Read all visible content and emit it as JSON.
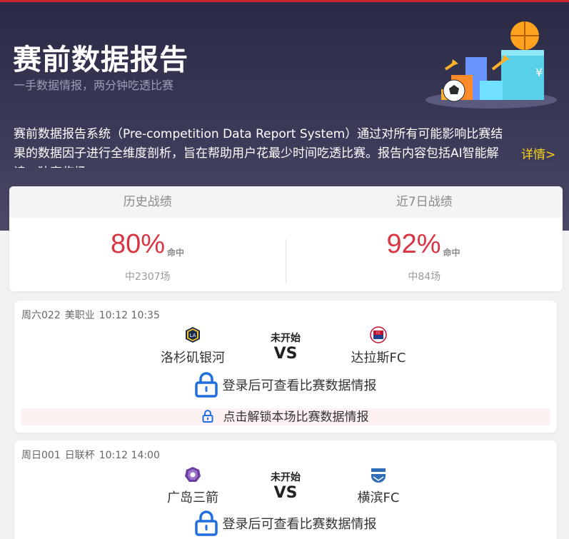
{
  "hero": {
    "title": "赛前数据报告",
    "subtitle": "一手数据情报，两分钟吃透比赛",
    "description": "赛前数据报告系统（Pre-competition Data Report System）通过对所有可能影响比赛结果的数据因子进行全维度剖析，旨在帮助用户花最少时间吃透比赛。报告内容包括AI智能解读、独家临场",
    "more_link": "详情>"
  },
  "stats": {
    "history": {
      "tab": "历史战绩",
      "percent": "80%",
      "label": "命中",
      "count": "中2307场"
    },
    "recent": {
      "tab": "近7日战绩",
      "percent": "92%",
      "label": "命中",
      "count": "中84场"
    }
  },
  "matches": [
    {
      "code": "周六022",
      "league": "美职业",
      "time": "10:12 10:35",
      "status": "未开始",
      "vs": "VS",
      "home": {
        "name": "洛杉矶银河",
        "logo": "la-galaxy-logo"
      },
      "away": {
        "name": "达拉斯FC",
        "logo": "fc-dallas-logo"
      },
      "login_text": "登录后可查看比赛数据情报",
      "unlock_text": "点击解锁本场比赛数据情报"
    },
    {
      "code": "周日001",
      "league": "日联杯",
      "time": "10:12 14:00",
      "status": "未开始",
      "vs": "VS",
      "home": {
        "name": "广岛三箭",
        "logo": "sanfrecce-hiroshima-logo"
      },
      "away": {
        "name": "横滨FC",
        "logo": "yokohama-fc-logo"
      },
      "login_text": "登录后可查看比赛数据情报"
    }
  ],
  "colors": {
    "accent_red": "#d93442",
    "link_yellow": "#ffd319",
    "lock_blue": "#1f6fe0",
    "hero_bg": "#2b2a45"
  }
}
